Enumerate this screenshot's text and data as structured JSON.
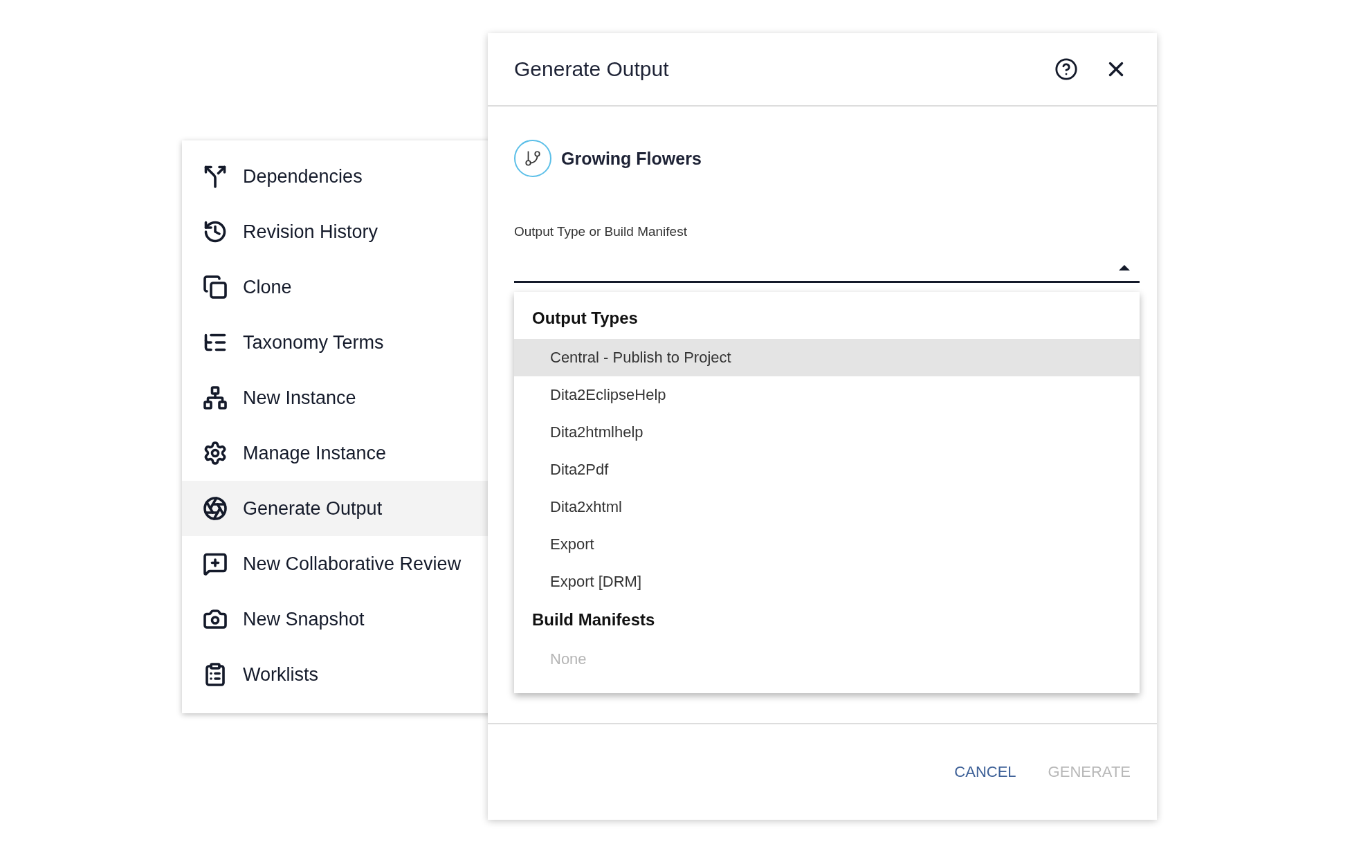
{
  "menu": {
    "items": [
      {
        "label": "Dependencies",
        "selected": false
      },
      {
        "label": "Revision History",
        "selected": false
      },
      {
        "label": "Clone",
        "selected": false
      },
      {
        "label": "Taxonomy Terms",
        "selected": false
      },
      {
        "label": "New Instance",
        "selected": false
      },
      {
        "label": "Manage Instance",
        "selected": false
      },
      {
        "label": "Generate Output",
        "selected": true
      },
      {
        "label": "New Collaborative Review",
        "selected": false
      },
      {
        "label": "New Snapshot",
        "selected": false
      },
      {
        "label": "Worklists",
        "selected": false
      }
    ]
  },
  "dialog": {
    "title": "Generate Output",
    "item_name": "Growing Flowers",
    "field": {
      "label": "Output Type or Build Manifest",
      "expanded": true
    },
    "dropdown": {
      "groups": [
        {
          "heading": "Output Types",
          "options": [
            {
              "label": "Central - Publish to Project",
              "selected": true,
              "disabled": false
            },
            {
              "label": "Dita2EclipseHelp",
              "selected": false,
              "disabled": false
            },
            {
              "label": "Dita2htmlhelp",
              "selected": false,
              "disabled": false
            },
            {
              "label": "Dita2Pdf",
              "selected": false,
              "disabled": false
            },
            {
              "label": "Dita2xhtml",
              "selected": false,
              "disabled": false
            },
            {
              "label": "Export",
              "selected": false,
              "disabled": false
            },
            {
              "label": "Export [DRM]",
              "selected": false,
              "disabled": false
            }
          ]
        },
        {
          "heading": "Build Manifests",
          "options": [
            {
              "label": "None",
              "selected": false,
              "disabled": true
            }
          ]
        }
      ]
    },
    "buttons": [
      {
        "label": "CANCEL",
        "disabled": false
      },
      {
        "label": "GENERATE",
        "disabled": true
      }
    ]
  }
}
